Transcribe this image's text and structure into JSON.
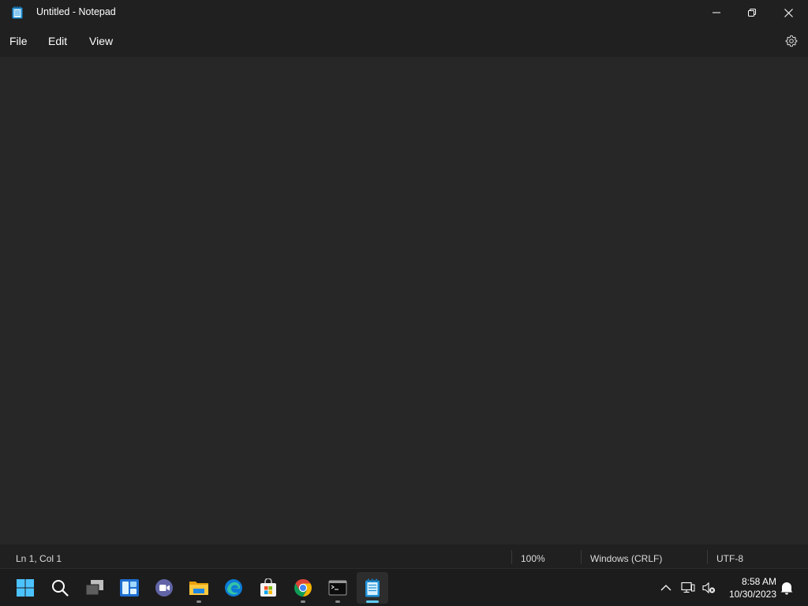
{
  "window": {
    "title": "Untitled - Notepad"
  },
  "menu": {
    "items": [
      "File",
      "Edit",
      "View"
    ]
  },
  "editor": {
    "content": ""
  },
  "status": {
    "position": "Ln 1, Col 1",
    "zoom": "100%",
    "line_ending": "Windows (CRLF)",
    "encoding": "UTF-8"
  },
  "taskbar": {
    "apps": [
      "start-icon",
      "search-icon",
      "task-view-icon",
      "widgets-icon",
      "teams-chat-icon",
      "file-explorer-icon",
      "edge-icon",
      "store-icon",
      "chrome-icon",
      "terminal-icon",
      "notepad-icon"
    ],
    "active_app": "notepad-icon",
    "clock": {
      "time": "8:58 AM",
      "date": "10/30/2023"
    }
  },
  "colors": {
    "title_bg": "#202020",
    "editor_bg": "#272727",
    "taskbar_bg": "#1c1c1c",
    "accent": "#60cdff"
  }
}
